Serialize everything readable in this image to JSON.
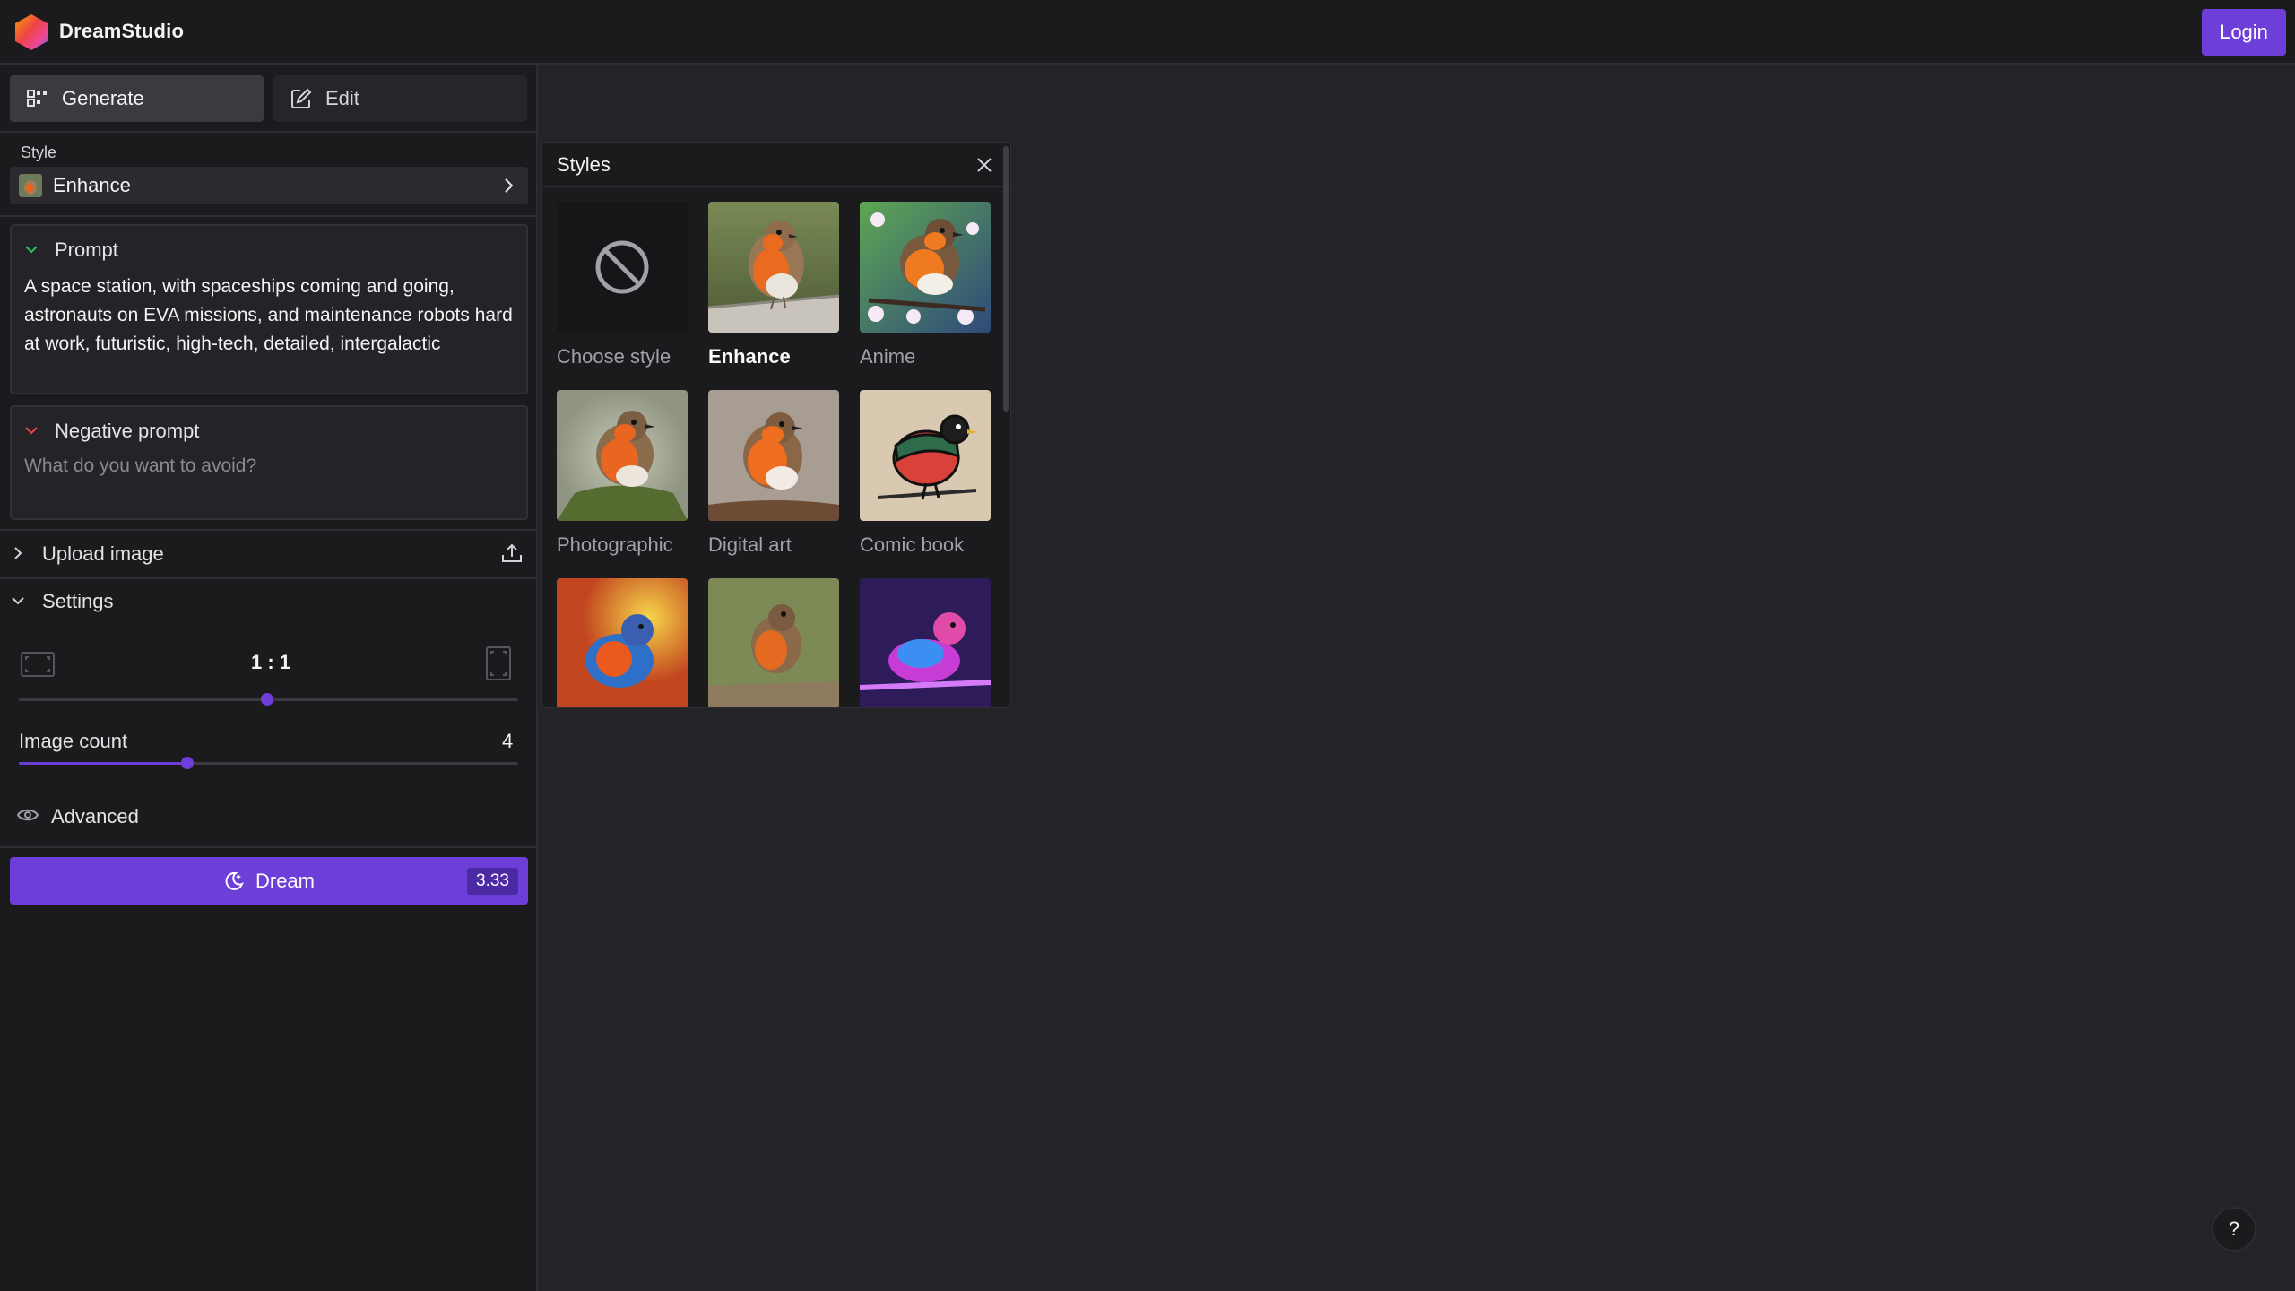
{
  "header": {
    "brand": "DreamStudio",
    "login_label": "Login"
  },
  "tabs": [
    {
      "label": "Generate",
      "icon": "grid-icon"
    },
    {
      "label": "Edit",
      "icon": "edit-icon"
    }
  ],
  "style": {
    "label": "Style",
    "value": "Enhance"
  },
  "prompt": {
    "title": "Prompt",
    "text": "A space station, with spaceships coming and going, astronauts on EVA missions, and maintenance robots hard at work, futuristic, high-tech, detailed, intergalactic"
  },
  "negative_prompt": {
    "title": "Negative prompt",
    "placeholder": "What do you want to avoid?"
  },
  "upload": {
    "label": "Upload image"
  },
  "settings": {
    "label": "Settings",
    "aspect_ratio": "1 : 1",
    "aspect_ratio_position": 0.5,
    "image_count_label": "Image count",
    "image_count": "4",
    "image_count_position": 0.34,
    "advanced_label": "Advanced"
  },
  "dream": {
    "label": "Dream",
    "credits": "3.33"
  },
  "styles_popover": {
    "title": "Styles",
    "items": [
      {
        "label": "Choose style",
        "selected": false
      },
      {
        "label": "Enhance",
        "selected": true
      },
      {
        "label": "Anime",
        "selected": false
      },
      {
        "label": "Photographic",
        "selected": false
      },
      {
        "label": "Digital art",
        "selected": false
      },
      {
        "label": "Comic book",
        "selected": false
      },
      {
        "label": "",
        "selected": false
      },
      {
        "label": "",
        "selected": false
      },
      {
        "label": "",
        "selected": false
      }
    ]
  },
  "help": {
    "label": "?"
  },
  "colors": {
    "accent": "#6d3fd8",
    "panel": "#1b1b1e",
    "canvas": "#242428"
  }
}
